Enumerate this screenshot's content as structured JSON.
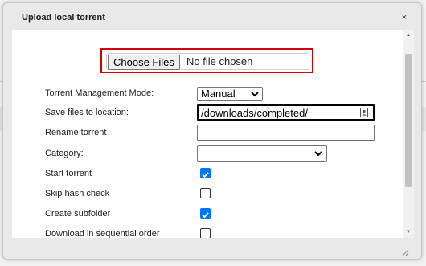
{
  "dialog": {
    "title": "Upload local torrent",
    "close_glyph": "×"
  },
  "file_picker": {
    "button_label": "Choose Files",
    "status_text": "No file chosen"
  },
  "form": {
    "management_mode": {
      "label": "Torrent Management Mode:",
      "value": "Manual"
    },
    "save_location": {
      "label": "Save files to location:",
      "value": "/downloads/completed/"
    },
    "rename": {
      "label": "Rename torrent",
      "value": ""
    },
    "category": {
      "label": "Category:",
      "value": ""
    },
    "start_torrent": {
      "label": "Start torrent",
      "checked": true
    },
    "skip_hash_check": {
      "label": "Skip hash check",
      "checked": false
    },
    "create_subfolder": {
      "label": "Create subfolder",
      "checked": true
    },
    "sequential_order": {
      "label": "Download in sequential order",
      "checked": false
    }
  },
  "icons": {
    "close": "close-icon",
    "chevron": "chevron-down-icon",
    "contact": "contact-card-icon",
    "checkmark": "checkmark-icon",
    "scroll_up": "scroll-up-arrow-icon",
    "scroll_down": "scroll-down-arrow-icon",
    "resize": "resize-grip-icon"
  },
  "colors": {
    "highlight_border": "#d40000",
    "checkbox_accent": "#0075ff"
  }
}
